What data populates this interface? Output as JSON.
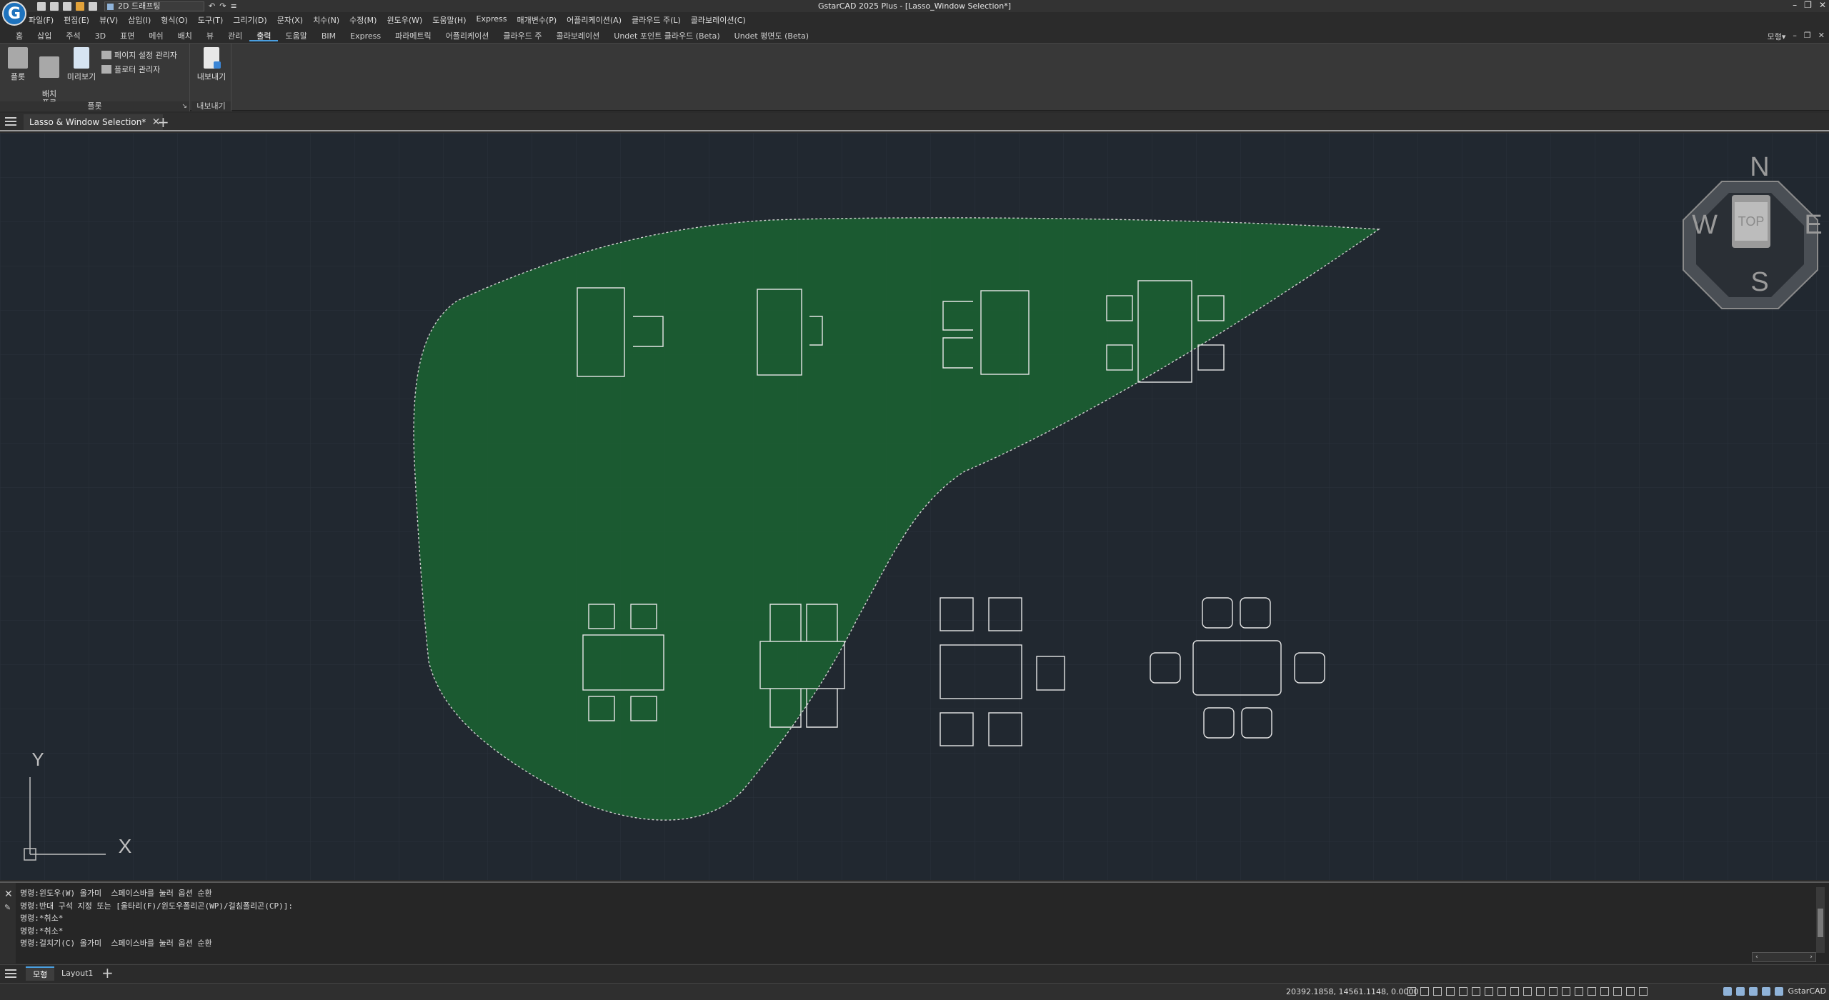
{
  "app": {
    "logo_letter": "G",
    "window_title": "GstarCAD 2025 Plus - [Lasso_Window Selection*]",
    "workspace": "2D 드래프팅",
    "win_min": "–",
    "win_max": "❐",
    "win_close": "✕"
  },
  "menubar": [
    "파일(F)",
    "편집(E)",
    "뷰(V)",
    "삽입(I)",
    "형식(O)",
    "도구(T)",
    "그리기(D)",
    "문자(X)",
    "치수(N)",
    "수정(M)",
    "윈도우(W)",
    "도움말(H)",
    "Express",
    "매개변수(P)",
    "어플리케이션(A)",
    "클라우드 주(L)",
    "콜라보레이션(C)"
  ],
  "ribbon_tabs": [
    "홈",
    "삽입",
    "주석",
    "3D",
    "표면",
    "메쉬",
    "배치",
    "뷰",
    "관리",
    "출력",
    "도움말",
    "BIM",
    "Express",
    "파라메트릭",
    "어플리케이션",
    "클라우드 주",
    "콜라보레이션",
    "Undet 포인트 클라우드 (Beta)",
    "Undet 평면도 (Beta)"
  ],
  "ribbon_active_tab": "출력",
  "ribbon_right": {
    "mode": "모형▾",
    "min": "–",
    "max": "❐",
    "close": "✕"
  },
  "ribbon": {
    "plot_panel": {
      "label": "플롯",
      "plot": "플롯",
      "batch_plot": "배치\n플롯",
      "preview": "미리보기",
      "page_setup": "페이지 설정 관리자",
      "plotter_manager": "플로터 관리자",
      "expander": "↘"
    },
    "export_panel": {
      "label": "내보내기",
      "export": "내보내기"
    }
  },
  "document": {
    "tab_title": "Lasso & Window Selection*",
    "close": "✕",
    "add": "+"
  },
  "viewcube": {
    "n": "N",
    "s": "S",
    "e": "E",
    "w": "W",
    "top": "TOP"
  },
  "ucs": {
    "x": "X",
    "y": "Y"
  },
  "colors": {
    "canvas_bg": "#212830",
    "lasso_fill": "#1b5e32",
    "lasso_stroke": "#d0d0d0",
    "entity": "#e6e6e6",
    "accent": "#4a9fe0"
  },
  "command": {
    "close": "✕",
    "pin": "✎",
    "history": [
      "명령:윈도우(W) 올가미  스페이스바를 눌러 옵션 순환",
      "명령:반대 구석 지정 또는 [울타리(F)/윈도우폴리곤(WP)/걸침폴리곤(CP)]:",
      "명령:*취소*",
      "명령:*취소*",
      "명령:걸치기(C) 올가미  스페이스바를 눌러 옵션 순환"
    ],
    "hscroll_left": "‹",
    "hscroll_right": "›"
  },
  "layout_tabs": [
    "모형",
    "Layout1"
  ],
  "layout_add": "+",
  "status": {
    "coords": "20392.1858, 14561.1148, 0.0000",
    "app_name": "GstarCAD"
  }
}
